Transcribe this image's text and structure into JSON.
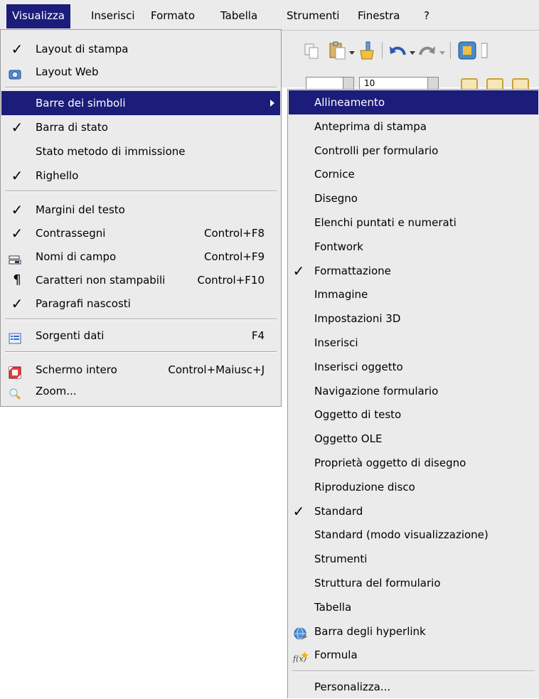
{
  "menubar": {
    "items": [
      {
        "label": "Visualizza",
        "active": true
      },
      {
        "label": "Inserisci"
      },
      {
        "label": "Formato"
      },
      {
        "label": "Tabella"
      },
      {
        "label": "Strumenti"
      },
      {
        "label": "Finestra"
      },
      {
        "label": "?"
      }
    ]
  },
  "main_menu": {
    "items": [
      {
        "label": "Layout di stampa",
        "checked": true
      },
      {
        "label": "Layout Web",
        "icon": "web-layout-icon"
      },
      {
        "label": "Barre dei simboli",
        "submenu": true,
        "highlighted": true
      },
      {
        "label": "Barra di stato",
        "checked": true
      },
      {
        "label": "Stato metodo di immissione"
      },
      {
        "label": "Righello",
        "checked": true
      },
      {
        "label": "Margini del testo",
        "checked": true
      },
      {
        "label": "Contrassegni",
        "checked": true,
        "shortcut": "Control+F8"
      },
      {
        "label": "Nomi di campo",
        "icon": "field-names-icon",
        "shortcut": "Control+F9"
      },
      {
        "label": "Caratteri non stampabili",
        "icon": "pilcrow-icon",
        "shortcut": "Control+F10"
      },
      {
        "label": "Paragrafi nascosti",
        "checked": true
      },
      {
        "label": "Sorgenti dati",
        "icon": "data-sources-icon",
        "shortcut": "F4"
      },
      {
        "label": "Schermo intero",
        "icon": "fullscreen-icon",
        "shortcut": "Control+Maiusc+J"
      },
      {
        "label": "Zoom...",
        "icon": "zoom-icon"
      }
    ]
  },
  "sub_menu": {
    "items": [
      {
        "label": "Allineamento",
        "highlighted": true
      },
      {
        "label": "Anteprima di stampa"
      },
      {
        "label": "Controlli per formulario"
      },
      {
        "label": "Cornice"
      },
      {
        "label": "Disegno"
      },
      {
        "label": "Elenchi puntati e numerati"
      },
      {
        "label": "Fontwork"
      },
      {
        "label": "Formattazione",
        "checked": true
      },
      {
        "label": "Immagine"
      },
      {
        "label": "Impostazioni 3D"
      },
      {
        "label": "Inserisci"
      },
      {
        "label": "Inserisci oggetto"
      },
      {
        "label": "Navigazione formulario"
      },
      {
        "label": "Oggetto di testo"
      },
      {
        "label": "Oggetto OLE"
      },
      {
        "label": "Proprietà oggetto di disegno"
      },
      {
        "label": "Riproduzione disco"
      },
      {
        "label": "Standard",
        "checked": true
      },
      {
        "label": "Standard (modo visualizzazione)"
      },
      {
        "label": "Strumenti"
      },
      {
        "label": "Struttura del formulario"
      },
      {
        "label": "Tabella"
      },
      {
        "label": "Barra degli hyperlink",
        "icon": "hyperlink-bar-icon"
      },
      {
        "label": "Formula",
        "icon": "formula-icon"
      },
      {
        "label": "Personalizza..."
      }
    ]
  },
  "colors": {
    "highlight": "#1c1c7a",
    "menu_bg": "#ebebeb"
  },
  "glyphs": {
    "check": "✓",
    "pilcrow": "¶"
  },
  "toolbar": {
    "font_size_value": "10"
  }
}
